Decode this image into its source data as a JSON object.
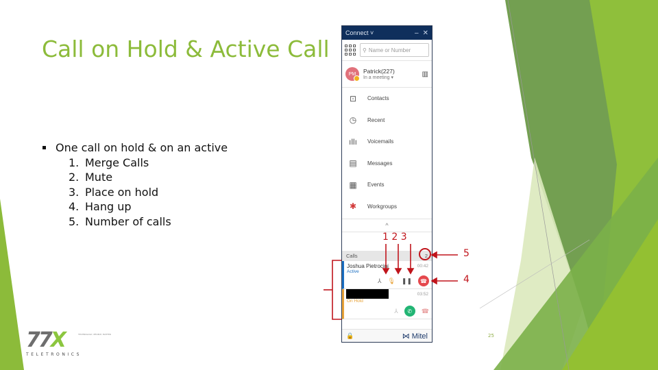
{
  "slide": {
    "title": "Call on Hold & Active Call",
    "bullet": "One call on hold & on an active",
    "items": [
      {
        "num": "1.",
        "text": "Merge Calls"
      },
      {
        "num": "2.",
        "text": "Mute"
      },
      {
        "num": "3.",
        "text": "Place on hold"
      },
      {
        "num": "4.",
        "text": "Hang up"
      },
      {
        "num": "5.",
        "text": "Number of calls"
      }
    ],
    "page_number": "25",
    "accent_color": "#8cbb3a"
  },
  "app": {
    "title": "Connect",
    "title_chevron": "˅",
    "minimize": "–",
    "close": "✕",
    "search_placeholder": "Name or Number",
    "profile": {
      "initials": "PM",
      "name": "Patrick(227)",
      "status": "In a meeting ▾"
    },
    "nav": [
      {
        "label": "Contacts",
        "icon": "contacts-icon"
      },
      {
        "label": "Recent",
        "icon": "clock-icon"
      },
      {
        "label": "Voicemails",
        "icon": "voicemail-icon"
      },
      {
        "label": "Messages",
        "icon": "message-icon"
      },
      {
        "label": "Events",
        "icon": "calendar-icon"
      },
      {
        "label": "Workgroups",
        "icon": "workgroups-icon"
      }
    ],
    "collapse": "^",
    "calls": {
      "header": "Calls",
      "count": "2",
      "list": [
        {
          "name": "Joshua Pietrocini",
          "state": "Active",
          "time": "00:42"
        },
        {
          "name": "",
          "state": "On Hold",
          "time": "03:52"
        }
      ]
    },
    "brand": "Mitel",
    "brand_mark": "⋈"
  },
  "annotations": {
    "top": "1  2  3",
    "count_label": "5",
    "hangup_label": "4"
  },
  "logo": {
    "mark": "TTX",
    "tagline": "TECHNOLOGY, PEOPLE, MATTER",
    "name": "TELETRONICS"
  }
}
